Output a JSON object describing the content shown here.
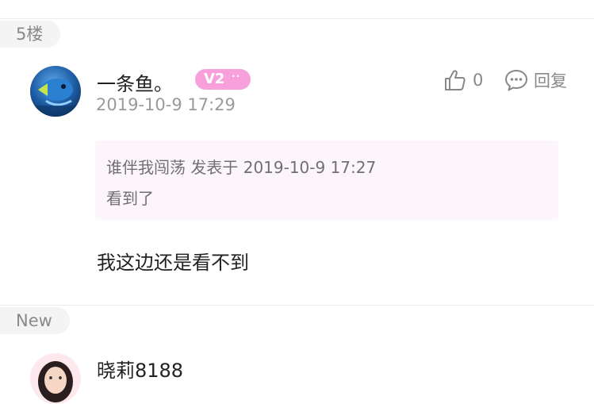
{
  "floor_label": "5楼",
  "post": {
    "username": "一条鱼。",
    "level": "V2",
    "level_dots": "··",
    "timestamp": "2019-10-9 17:29",
    "like_count": "0",
    "reply_label": "回复",
    "quote": {
      "header": "谁伴我闯荡 发表于 2019-10-9 17:27",
      "text": "看到了"
    },
    "body": "我这边还是看不到"
  },
  "new_label": "New",
  "next_post": {
    "username": "晓莉8188"
  },
  "colors": {
    "badge": "#f7a0dc",
    "quote_bg": "#fcf5fc"
  }
}
